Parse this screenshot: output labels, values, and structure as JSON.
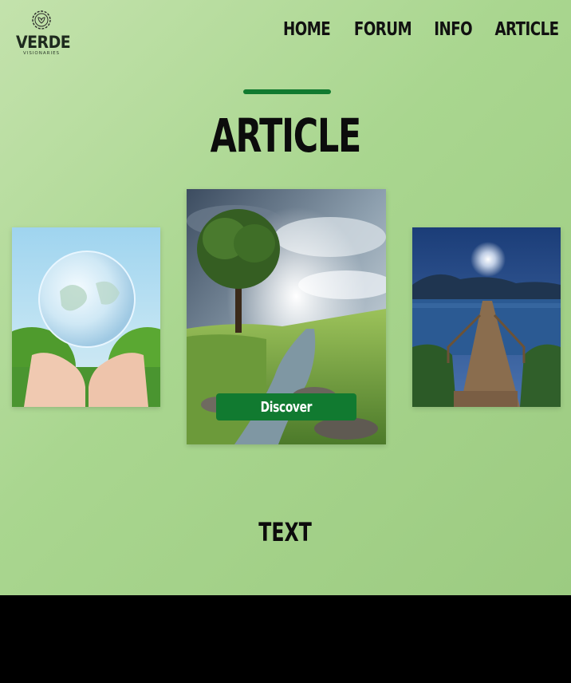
{
  "brand": {
    "name": "VERDE",
    "tagline": "VISIONARIES"
  },
  "nav": {
    "items": [
      "HOME",
      "FORUM",
      "INFO",
      "ARTICLE"
    ]
  },
  "main": {
    "title": "ARTICLE",
    "carousel": {
      "discover_label": "Discover",
      "cards": [
        {
          "image": "hands-holding-globe-image"
        },
        {
          "image": "tree-and-stream-image"
        },
        {
          "image": "lake-pier-night-image"
        }
      ]
    },
    "section_text": "TEXT"
  },
  "colors": {
    "accent": "#117a30",
    "background": "#a9d68f",
    "footer": "#000000"
  }
}
